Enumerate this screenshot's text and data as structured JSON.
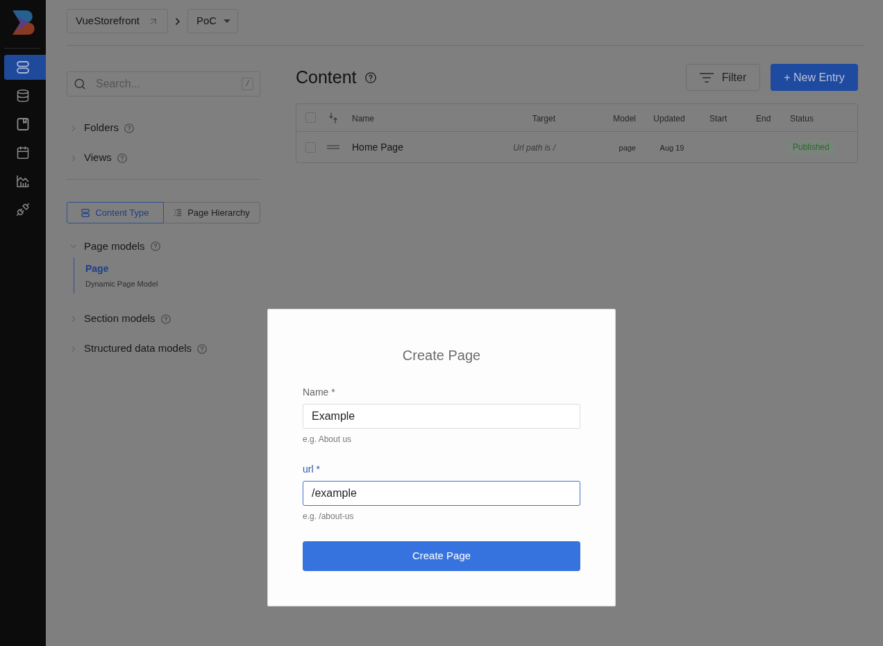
{
  "nav_rail": [
    {
      "kind": "stack",
      "selected": true
    },
    {
      "kind": "database",
      "selected": false
    },
    {
      "kind": "book",
      "selected": false
    },
    {
      "kind": "calendar",
      "selected": false
    },
    {
      "kind": "chart",
      "selected": false
    },
    {
      "kind": "plug",
      "selected": false
    }
  ],
  "breadcrumb": [
    {
      "label": "VueStorefront",
      "kind": "link"
    },
    {
      "label": "PoC",
      "kind": "dropdown"
    }
  ],
  "sidebar": {
    "search": {
      "placeholder": "Search...",
      "shortcut": "/"
    },
    "sections": [
      {
        "label": "Folders",
        "expanded": false
      },
      {
        "label": "Views",
        "expanded": false
      }
    ],
    "view_toggle": [
      {
        "label": "Content Type",
        "kind": "stack",
        "selected": true
      },
      {
        "label": "Page Hierarchy",
        "kind": "hierarchy",
        "selected": false
      }
    ],
    "model_groups": [
      {
        "label": "Page models",
        "expanded": true,
        "children": [
          {
            "label": "Page",
            "description": "Dynamic Page Model",
            "selected": true
          }
        ]
      },
      {
        "label": "Section models",
        "expanded": false
      },
      {
        "label": "Structured data models",
        "expanded": false
      }
    ]
  },
  "content": {
    "title": "Content",
    "filter_button": "Filter",
    "new_entry_button": "+ New Entry",
    "table": {
      "all_checked": false,
      "columns": [
        "Name",
        "Target",
        "Model",
        "Updated",
        "Start",
        "End",
        "Status"
      ],
      "rows": [
        {
          "checked": false,
          "name": "Home Page",
          "target": "Url path is /",
          "model": "page",
          "updated": "Aug 19",
          "status": "Published"
        }
      ]
    }
  },
  "dialog": {
    "title": "Create Page",
    "fields": [
      {
        "label": "Name *",
        "value": "Example",
        "hint": "e.g. About us",
        "focused": false
      },
      {
        "label": "url *",
        "value": "/example",
        "hint": "e.g. /about-us",
        "focused": true
      }
    ],
    "submit": "Create Page"
  }
}
